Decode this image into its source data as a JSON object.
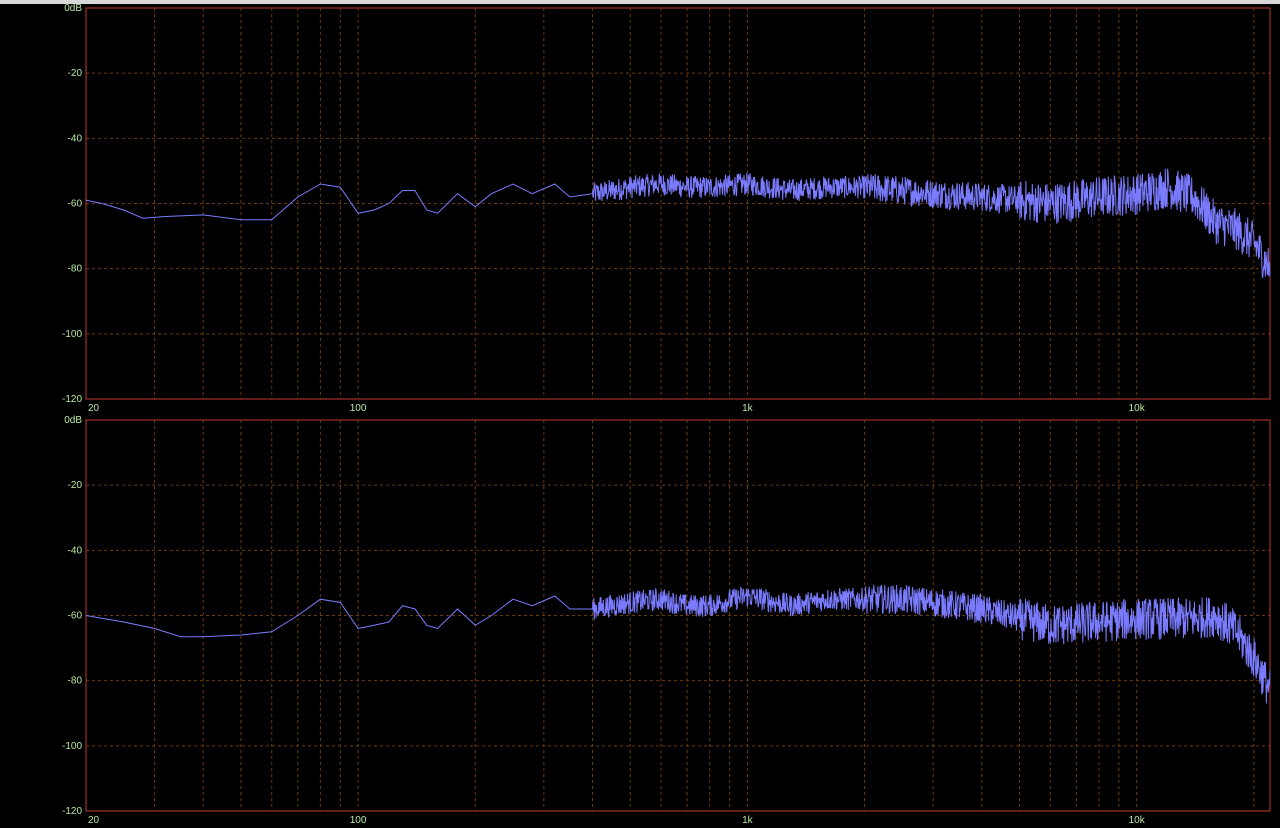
{
  "colors": {
    "background": "#000000",
    "frame": "#c0392b",
    "grid": "#6b3a0a",
    "trace": "#7b7bff",
    "tick_label": "#b8e8a0"
  },
  "chart_data": [
    {
      "type": "line",
      "x_scale": "log",
      "xlim": [
        20,
        22000
      ],
      "ylim": [
        -120,
        0
      ],
      "grid": true,
      "y_ticks": [
        0,
        -20,
        -40,
        -60,
        -80,
        -100,
        -120
      ],
      "y_tick_labels": [
        "0dB",
        "-20",
        "-40",
        "-60",
        "-80",
        "-100",
        "-120"
      ],
      "x_tick_labels": [
        {
          "value": 20,
          "label": "20"
        },
        {
          "value": 100,
          "label": "100"
        },
        {
          "value": 1000,
          "label": "1k"
        },
        {
          "value": 10000,
          "label": "10k"
        }
      ],
      "anchors": [
        [
          20,
          -59
        ],
        [
          22,
          -60
        ],
        [
          25,
          -62
        ],
        [
          28,
          -64.5
        ],
        [
          32,
          -64
        ],
        [
          40,
          -63.5
        ],
        [
          50,
          -65
        ],
        [
          60,
          -65
        ],
        [
          70,
          -58
        ],
        [
          80,
          -54
        ],
        [
          90,
          -55
        ],
        [
          100,
          -63
        ],
        [
          110,
          -62
        ],
        [
          120,
          -60
        ],
        [
          130,
          -56
        ],
        [
          140,
          -56
        ],
        [
          150,
          -62
        ],
        [
          160,
          -63
        ],
        [
          180,
          -57
        ],
        [
          200,
          -61
        ],
        [
          220,
          -57
        ],
        [
          250,
          -54
        ],
        [
          280,
          -57
        ],
        [
          320,
          -54
        ],
        [
          350,
          -58
        ],
        [
          400,
          -57
        ],
        [
          500,
          -55
        ],
        [
          600,
          -54
        ],
        [
          700,
          -55
        ],
        [
          800,
          -55
        ],
        [
          1000,
          -54
        ],
        [
          1300,
          -56
        ],
        [
          1600,
          -55
        ],
        [
          2000,
          -55
        ],
        [
          2500,
          -56
        ],
        [
          3000,
          -57
        ],
        [
          4000,
          -58
        ],
        [
          5000,
          -59
        ],
        [
          6000,
          -60
        ],
        [
          8000,
          -58
        ],
        [
          10000,
          -57
        ],
        [
          12000,
          -55
        ],
        [
          14000,
          -58
        ],
        [
          16000,
          -66
        ],
        [
          18000,
          -68
        ],
        [
          20000,
          -72
        ],
        [
          22000,
          -80
        ]
      ]
    },
    {
      "type": "line",
      "x_scale": "log",
      "xlim": [
        20,
        22000
      ],
      "ylim": [
        -120,
        0
      ],
      "grid": true,
      "y_ticks": [
        0,
        -20,
        -40,
        -60,
        -80,
        -100,
        -120
      ],
      "y_tick_labels": [
        "0dB",
        "-20",
        "-40",
        "-60",
        "-80",
        "-100",
        "-120"
      ],
      "x_tick_labels": [
        {
          "value": 20,
          "label": "20"
        },
        {
          "value": 100,
          "label": "100"
        },
        {
          "value": 1000,
          "label": "1k"
        },
        {
          "value": 10000,
          "label": "10k"
        }
      ],
      "anchors": [
        [
          20,
          -60
        ],
        [
          25,
          -62
        ],
        [
          30,
          -64
        ],
        [
          35,
          -66.5
        ],
        [
          40,
          -66.5
        ],
        [
          50,
          -66
        ],
        [
          60,
          -65
        ],
        [
          70,
          -60
        ],
        [
          80,
          -55
        ],
        [
          90,
          -56
        ],
        [
          100,
          -64
        ],
        [
          110,
          -63
        ],
        [
          120,
          -62
        ],
        [
          130,
          -57
        ],
        [
          140,
          -58
        ],
        [
          150,
          -63
        ],
        [
          160,
          -64
        ],
        [
          180,
          -58
        ],
        [
          200,
          -63
        ],
        [
          220,
          -60
        ],
        [
          250,
          -55
        ],
        [
          280,
          -57
        ],
        [
          320,
          -54
        ],
        [
          350,
          -58
        ],
        [
          400,
          -58
        ],
        [
          500,
          -56
        ],
        [
          600,
          -55
        ],
        [
          700,
          -57
        ],
        [
          800,
          -57
        ],
        [
          1000,
          -54
        ],
        [
          1300,
          -57
        ],
        [
          1600,
          -55
        ],
        [
          2000,
          -55
        ],
        [
          2500,
          -55
        ],
        [
          3000,
          -56
        ],
        [
          4000,
          -58
        ],
        [
          5000,
          -61
        ],
        [
          6000,
          -63
        ],
        [
          8000,
          -62
        ],
        [
          10000,
          -61
        ],
        [
          12000,
          -61
        ],
        [
          14000,
          -61
        ],
        [
          16000,
          -60
        ],
        [
          18000,
          -65
        ],
        [
          20000,
          -73
        ],
        [
          22000,
          -83
        ]
      ]
    }
  ]
}
